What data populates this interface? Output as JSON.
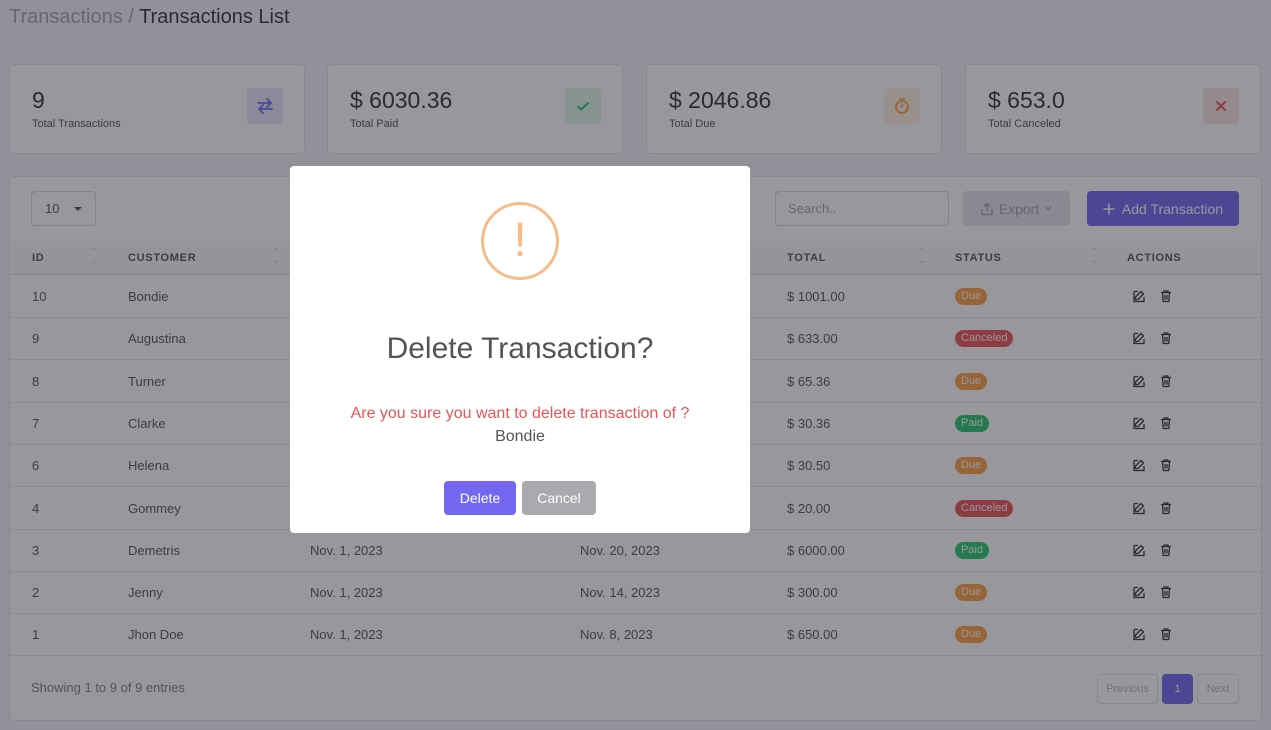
{
  "breadcrumb": {
    "parent": "Transactions /",
    "current": "Transactions List"
  },
  "stats": [
    {
      "value": "9",
      "label": "Total Transactions",
      "icon": "transfer-icon",
      "color": "#7367f0",
      "bg": "#e8e6fc"
    },
    {
      "value": "$ 6030.36",
      "label": "Total Paid",
      "icon": "check-icon",
      "color": "#28c76f",
      "bg": "#dff7e9"
    },
    {
      "value": "$ 2046.86",
      "label": "Total Due",
      "icon": "timer-icon",
      "color": "#ff9f43",
      "bg": "#fff1e3"
    },
    {
      "value": "$ 653.0",
      "label": "Total Canceled",
      "icon": "close-icon",
      "color": "#ea5455",
      "bg": "#fce4e4"
    }
  ],
  "toolbar": {
    "page_length": "10",
    "search_placeholder": "Search..",
    "export_label": "Export",
    "add_label": "Add Transaction"
  },
  "table": {
    "headers": {
      "id": "ID",
      "customer": "CUSTOMER",
      "total": "TOTAL",
      "status": "STATUS",
      "actions": "ACTIONS"
    },
    "rows": [
      {
        "id": "10",
        "customer": "Bondie",
        "issued": "",
        "due": "",
        "total": "$ 1001.00",
        "status": "Due",
        "status_type": "due"
      },
      {
        "id": "9",
        "customer": "Augustina",
        "issued": "",
        "due": "",
        "total": "$ 633.00",
        "status": "Canceled",
        "status_type": "canceled"
      },
      {
        "id": "8",
        "customer": "Turner",
        "issued": "",
        "due": "",
        "total": "$ 65.36",
        "status": "Due",
        "status_type": "due"
      },
      {
        "id": "7",
        "customer": "Clarke",
        "issued": "",
        "due": "",
        "total": "$ 30.36",
        "status": "Paid",
        "status_type": "paid"
      },
      {
        "id": "6",
        "customer": "Helena",
        "issued": "",
        "due": "",
        "total": "$ 30.50",
        "status": "Due",
        "status_type": "due"
      },
      {
        "id": "4",
        "customer": "Gommey",
        "issued": "",
        "due": "",
        "total": "$ 20.00",
        "status": "Canceled",
        "status_type": "canceled"
      },
      {
        "id": "3",
        "customer": "Demetris",
        "issued": "Nov. 1, 2023",
        "due": "Nov. 20, 2023",
        "total": "$ 6000.00",
        "status": "Paid",
        "status_type": "paid"
      },
      {
        "id": "2",
        "customer": "Jenny",
        "issued": "Nov. 1, 2023",
        "due": "Nov. 14, 2023",
        "total": "$ 300.00",
        "status": "Due",
        "status_type": "due"
      },
      {
        "id": "1",
        "customer": "Jhon Doe",
        "issued": "Nov. 1, 2023",
        "due": "Nov. 8, 2023",
        "total": "$ 650.00",
        "status": "Due",
        "status_type": "due"
      }
    ]
  },
  "footer": {
    "info": "Showing 1 to 9 of 9 entries",
    "previous": "Previous",
    "page": "1",
    "next": "Next"
  },
  "modal": {
    "title": "Delete Transaction?",
    "question": "Are you sure you want to delete transaction of ?",
    "customer": "Bondie",
    "delete_label": "Delete",
    "cancel_label": "Cancel",
    "icon": "warning-icon",
    "icon_glyph": "!"
  }
}
